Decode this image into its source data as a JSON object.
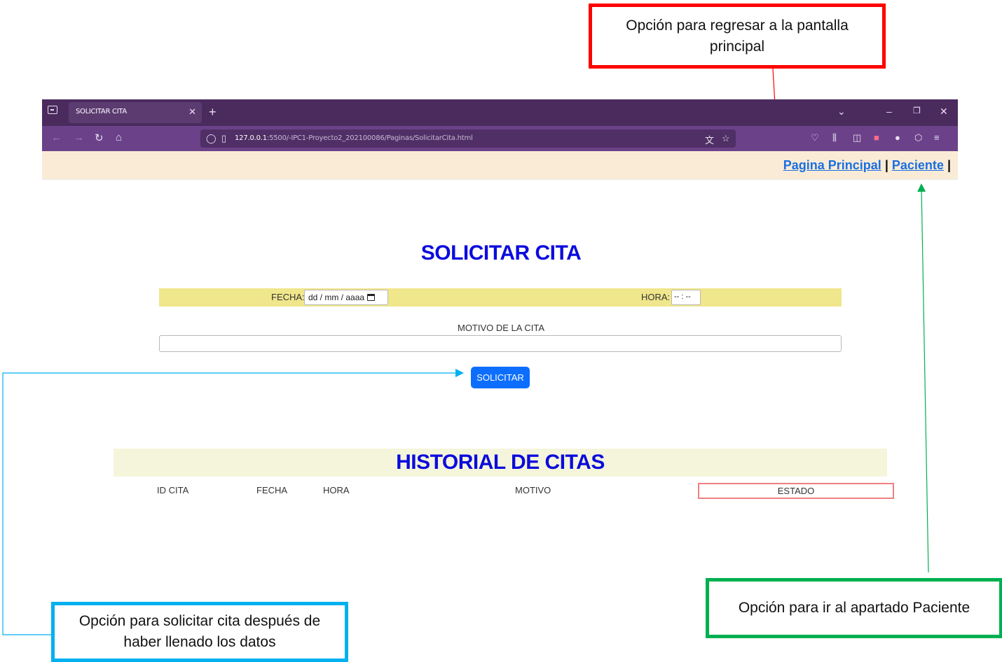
{
  "annotations": {
    "main_page": "Opción para regresar a la pantalla principal",
    "solicit": "Opción para solicitar cita después de haber llenado los datos",
    "patient": "Opción para ir al apartado Paciente"
  },
  "browser": {
    "tab_title": "SOLICITAR CITA",
    "url_host": "127.0.0.1",
    "url_path": ":5500/-IPC1-Proyecto2_202100086/Paginas/SolicitarCita.html"
  },
  "nav": {
    "link_main": "Pagina Principal",
    "sep1": "|",
    "link_patient": "Paciente",
    "sep2": "|"
  },
  "form": {
    "title": "SOLICITAR CITA",
    "fecha_label": "FECHA:",
    "fecha_placeholder": "dd / mm / aaaa",
    "hora_label": "HORA:",
    "hora_placeholder": "-- : --",
    "motivo_label": "MOTIVO DE LA CITA",
    "motivo_value": "",
    "submit_label": "SOLICITAR"
  },
  "history": {
    "title": "HISTORIAL DE CITAS",
    "columns": [
      "ID CITA",
      "FECHA",
      "HORA",
      "MOTIVO",
      "ESTADO"
    ],
    "rows": []
  },
  "colors": {
    "callout_red": "#ff0000",
    "callout_blue": "#00b0f0",
    "callout_green": "#00b050",
    "heading_blue": "#0b0bdd",
    "button_blue": "#0d6efd",
    "form_bar": "#f0e68c",
    "history_band": "#f5f5dc",
    "nav_band": "#faebd7",
    "browser_purple": "#4b2b5e"
  }
}
